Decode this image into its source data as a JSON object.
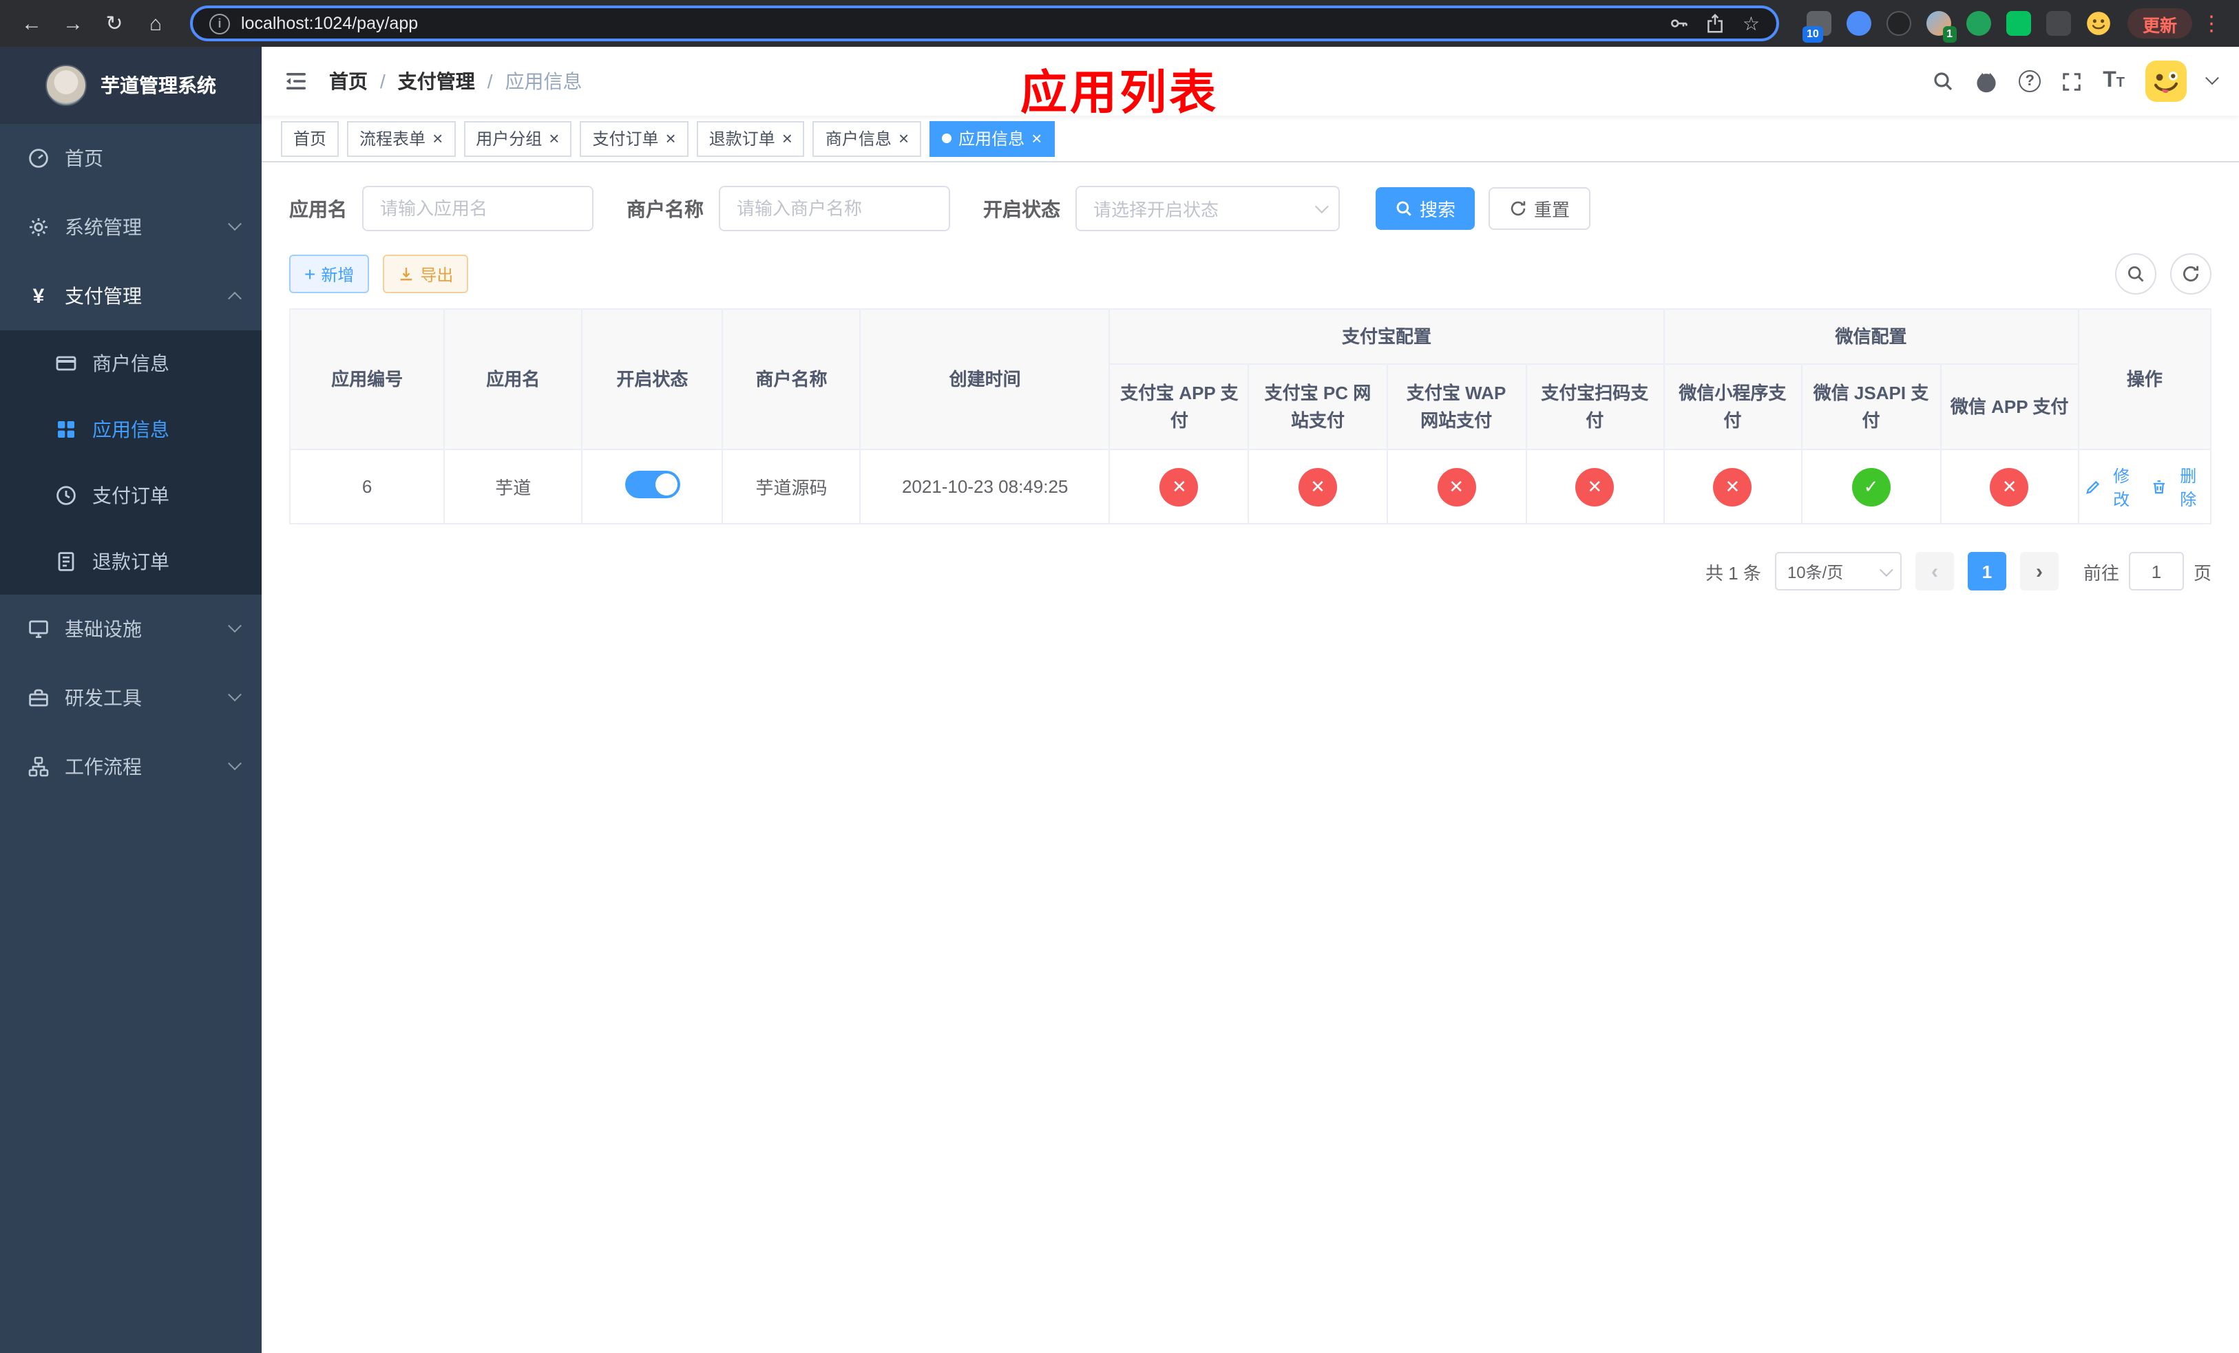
{
  "icons": {
    "back": "←",
    "forward": "→",
    "reload": "↻",
    "home": "⌂",
    "menu_dots": "⋮",
    "star": "☆",
    "close": "×",
    "plus": "+",
    "yen": "¥",
    "prev": "‹",
    "next": "›",
    "check": "✓",
    "cross": "✕",
    "info": "i",
    "question": "?",
    "font_size_big": "T",
    "font_size_small": "T"
  },
  "colors": {
    "accent": "#409EFF",
    "success": "#3fc42a",
    "danger": "#f65656",
    "warning": "#E6A23C",
    "sidebar_bg": "#304156",
    "submenu_bg": "#1f2d3d",
    "annotation_red": "#ff0000"
  },
  "browser": {
    "url": "localhost:1024/pay/app",
    "update_button": "更新",
    "extension_badge_1": "10",
    "extension_badge_2": "1"
  },
  "sidebar": {
    "app_title": "芋道管理系统",
    "items": [
      {
        "label": "首页"
      },
      {
        "label": "系统管理"
      },
      {
        "label": "支付管理"
      },
      {
        "label": "基础设施"
      },
      {
        "label": "研发工具"
      },
      {
        "label": "工作流程"
      }
    ],
    "submenu": [
      {
        "label": "商户信息"
      },
      {
        "label": "应用信息"
      },
      {
        "label": "支付订单"
      },
      {
        "label": "退款订单"
      }
    ]
  },
  "header": {
    "breadcrumb": [
      {
        "label": "首页"
      },
      {
        "label": "支付管理"
      },
      {
        "label": "应用信息"
      }
    ],
    "breadcrumb_separator": "/",
    "annotation": "应用列表"
  },
  "tabs": [
    {
      "label": "首页"
    },
    {
      "label": "流程表单"
    },
    {
      "label": "用户分组"
    },
    {
      "label": "支付订单"
    },
    {
      "label": "退款订单"
    },
    {
      "label": "商户信息"
    },
    {
      "label": "应用信息"
    }
  ],
  "filters": {
    "app_name_label": "应用名",
    "app_name_placeholder": "请输入应用名",
    "merchant_label": "商户名称",
    "merchant_placeholder": "请输入商户名称",
    "status_label": "开启状态",
    "status_placeholder": "请选择开启状态",
    "search_button": "搜索",
    "reset_button": "重置"
  },
  "toolbar": {
    "add_button": "新增",
    "export_button": "导出"
  },
  "table": {
    "simple_columns": [
      "应用编号",
      "应用名",
      "开启状态",
      "商户名称",
      "创建时间"
    ],
    "groups": [
      {
        "label": "支付宝配置",
        "children": [
          "支付宝 APP 支付",
          "支付宝 PC 网站支付",
          "支付宝 WAP 网站支付",
          "支付宝扫码支付"
        ]
      },
      {
        "label": "微信配置",
        "children": [
          "微信小程序支付",
          "微信 JSAPI 支付",
          "微信 APP 支付"
        ]
      }
    ],
    "actions_column": "操作",
    "rows": [
      {
        "id": "6",
        "name": "芋道",
        "enabled": true,
        "merchant": "芋道源码",
        "created_at": "2021-10-23 08:49:25",
        "configs": [
          false,
          false,
          false,
          false,
          false,
          true,
          false
        ],
        "edit_label": "修改",
        "delete_label": "删除"
      }
    ]
  },
  "pagination": {
    "total": "共 1 条",
    "page_size": "10条/页",
    "page": "1",
    "goto_label": "前往",
    "goto_value": "1",
    "goto_suffix": "页"
  }
}
